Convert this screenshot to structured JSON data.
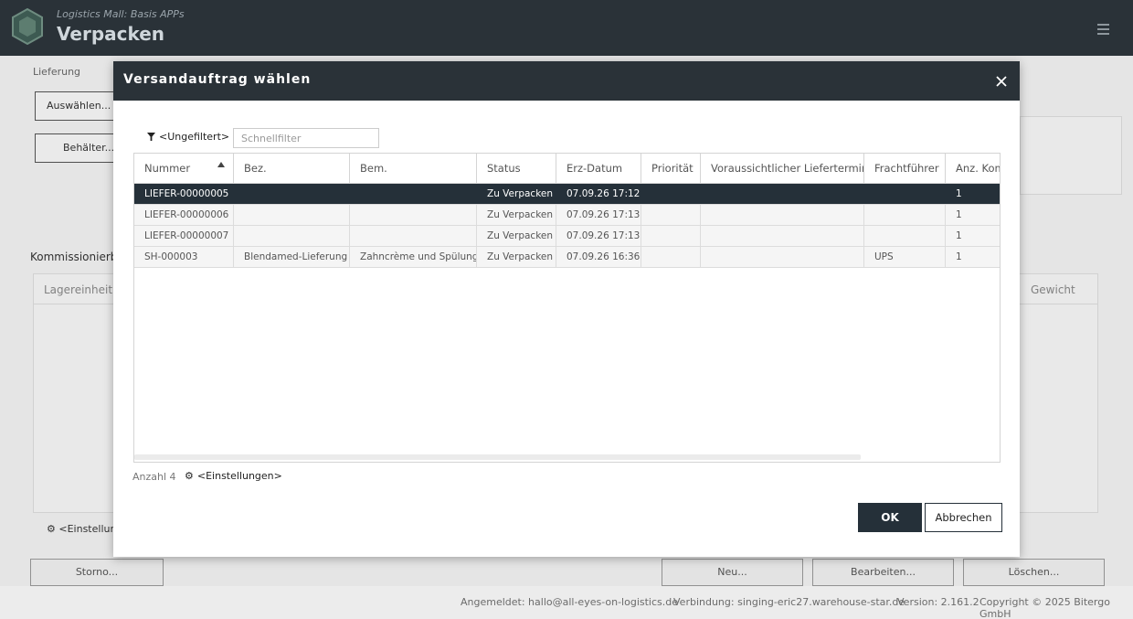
{
  "header": {
    "subtitle": "Logistics Mall: Basis APPs",
    "title": "Verpacken"
  },
  "background": {
    "delivery_label": "Lieferung",
    "select_button": "Auswählen...",
    "container_button": "Behälter...",
    "picking_label": "Kommissionierbe",
    "storage_unit_col": "Lagereinheit",
    "weight_col": "Gewicht",
    "settings_link": "<Einstellun",
    "cancel_order_button": "Storno...",
    "new_button": "Neu...",
    "edit_button": "Bearbeiten...",
    "delete_button": "Löschen..."
  },
  "statusbar": {
    "logged_in": "Angemeldet: hallo@all-eyes-on-logistics.de",
    "connection": "Verbindung: singing-eric27.warehouse-star.de",
    "version": "Version: 2.161.2",
    "copyright": "Copyright © 2025 Bitergo GmbH"
  },
  "dialog": {
    "title": "Versandauftrag wählen",
    "filter_label": "<Ungefiltert>",
    "quickfilter_placeholder": "Schnellfilter",
    "columns": [
      "Nummer",
      "Bez.",
      "Bem.",
      "Status",
      "Erz-Datum",
      "Priorität",
      "Voraussichtlicher Liefertermin",
      "Frachtführer",
      "Anz. Kom"
    ],
    "rows": [
      [
        "LIEFER-00000005",
        "",
        "",
        "Zu Verpacken",
        "07.09.26 17:12",
        "",
        "",
        "",
        "1"
      ],
      [
        "LIEFER-00000006",
        "",
        "",
        "Zu Verpacken",
        "07.09.26 17:13",
        "",
        "",
        "",
        "1"
      ],
      [
        "LIEFER-00000007",
        "",
        "",
        "Zu Verpacken",
        "07.09.26 17:13",
        "",
        "",
        "",
        "1"
      ],
      [
        "SH-000003",
        "Blendamed-Lieferung",
        "Zahncrème und Spülung",
        "Zu Verpacken",
        "07.09.26 16:36",
        "",
        "",
        "UPS",
        "1"
      ]
    ],
    "count_label": "Anzahl 4",
    "settings_label": "<Einstellungen>",
    "ok_label": "OK",
    "cancel_label": "Abbrechen"
  },
  "colors": {
    "header_bg": "#2a3238",
    "selected_row": "#253039",
    "primary_button": "#253039"
  }
}
